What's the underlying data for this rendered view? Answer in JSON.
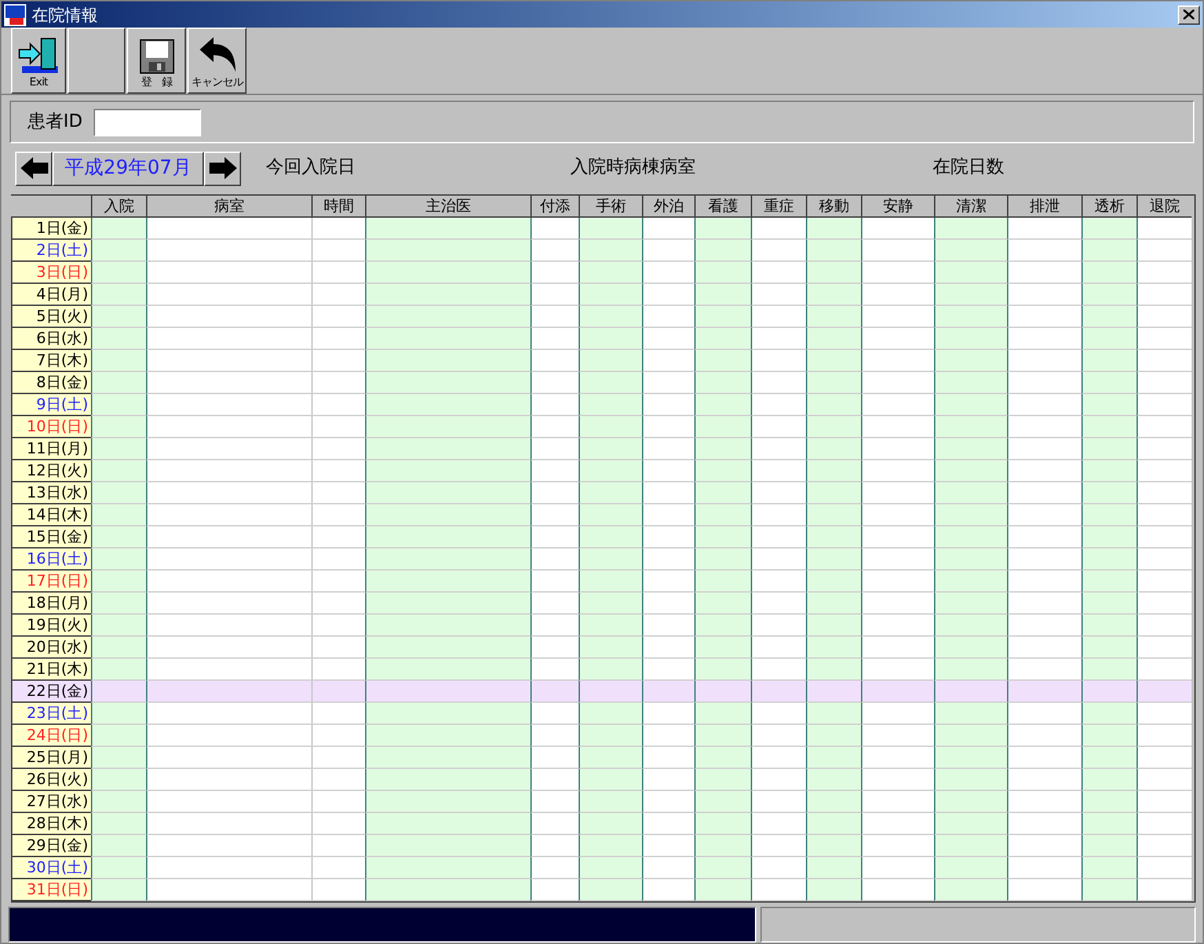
{
  "window": {
    "title": "在院情報"
  },
  "toolbar": [
    {
      "kind": "exit",
      "label": "Exit"
    },
    {
      "kind": "blank"
    },
    {
      "kind": "save",
      "label": "登　録"
    },
    {
      "kind": "cancel",
      "label": "キャンセル"
    }
  ],
  "patient": {
    "label": "患者ID"
  },
  "month_nav": {
    "month": "平成29年07月"
  },
  "info_labels": [
    "今回入院日",
    "入院時病棟病室",
    "在院日数"
  ],
  "table": {
    "columns": [
      {
        "label": "入院",
        "shaded": true
      },
      {
        "label": "病室",
        "shaded": false
      },
      {
        "label": "時間",
        "shaded": false
      },
      {
        "label": "主治医",
        "shaded": true
      },
      {
        "label": "付添",
        "shaded": false
      },
      {
        "label": "手術",
        "shaded": true
      },
      {
        "label": "外泊",
        "shaded": false
      },
      {
        "label": "看護",
        "shaded": true
      },
      {
        "label": "重症",
        "shaded": false
      },
      {
        "label": "移動",
        "shaded": true
      },
      {
        "label": "安静",
        "shaded": false
      },
      {
        "label": "清潔",
        "shaded": true
      },
      {
        "label": "排泄",
        "shaded": false
      },
      {
        "label": "透析",
        "shaded": true
      },
      {
        "label": "退院",
        "shaded": false
      }
    ],
    "rows": [
      {
        "day": "1日(金)",
        "kind": "weekday",
        "selected": false
      },
      {
        "day": "2日(土)",
        "kind": "saturday",
        "selected": false
      },
      {
        "day": "3日(日)",
        "kind": "sunday",
        "selected": false
      },
      {
        "day": "4日(月)",
        "kind": "weekday",
        "selected": false
      },
      {
        "day": "5日(火)",
        "kind": "weekday",
        "selected": false
      },
      {
        "day": "6日(水)",
        "kind": "weekday",
        "selected": false
      },
      {
        "day": "7日(木)",
        "kind": "weekday",
        "selected": false
      },
      {
        "day": "8日(金)",
        "kind": "weekday",
        "selected": false
      },
      {
        "day": "9日(土)",
        "kind": "saturday",
        "selected": false
      },
      {
        "day": "10日(日)",
        "kind": "sunday",
        "selected": false
      },
      {
        "day": "11日(月)",
        "kind": "weekday",
        "selected": false
      },
      {
        "day": "12日(火)",
        "kind": "weekday",
        "selected": false
      },
      {
        "day": "13日(水)",
        "kind": "weekday",
        "selected": false
      },
      {
        "day": "14日(木)",
        "kind": "weekday",
        "selected": false
      },
      {
        "day": "15日(金)",
        "kind": "weekday",
        "selected": false
      },
      {
        "day": "16日(土)",
        "kind": "saturday",
        "selected": false
      },
      {
        "day": "17日(日)",
        "kind": "sunday",
        "selected": false
      },
      {
        "day": "18日(月)",
        "kind": "weekday",
        "selected": false
      },
      {
        "day": "19日(火)",
        "kind": "weekday",
        "selected": false
      },
      {
        "day": "20日(水)",
        "kind": "weekday",
        "selected": false
      },
      {
        "day": "21日(木)",
        "kind": "weekday",
        "selected": false
      },
      {
        "day": "22日(金)",
        "kind": "weekday",
        "selected": true
      },
      {
        "day": "23日(土)",
        "kind": "saturday",
        "selected": false
      },
      {
        "day": "24日(日)",
        "kind": "sunday",
        "selected": false
      },
      {
        "day": "25日(月)",
        "kind": "weekday",
        "selected": false
      },
      {
        "day": "26日(火)",
        "kind": "weekday",
        "selected": false
      },
      {
        "day": "27日(水)",
        "kind": "weekday",
        "selected": false
      },
      {
        "day": "28日(木)",
        "kind": "weekday",
        "selected": false
      },
      {
        "day": "29日(金)",
        "kind": "weekday",
        "selected": false
      },
      {
        "day": "30日(土)",
        "kind": "saturday",
        "selected": false
      },
      {
        "day": "31日(日)",
        "kind": "sunday",
        "selected": false
      }
    ]
  }
}
